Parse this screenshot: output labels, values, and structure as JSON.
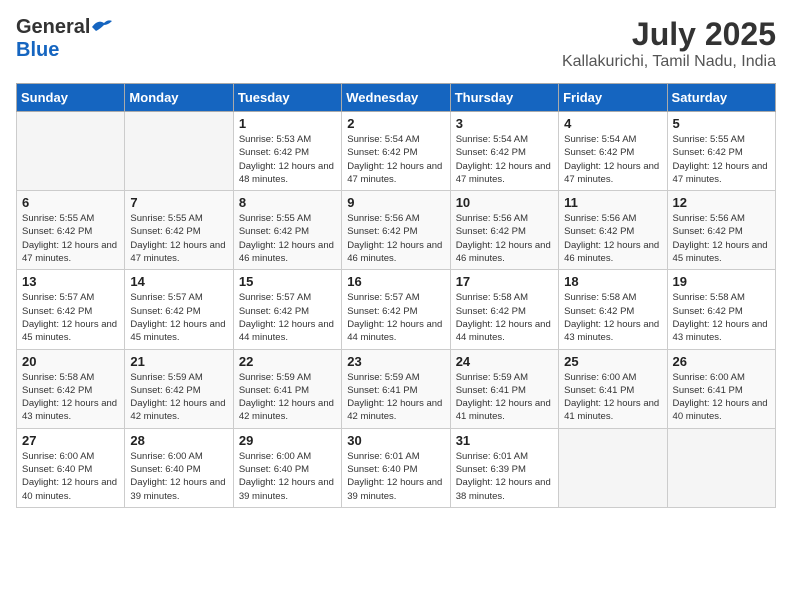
{
  "header": {
    "logo_general": "General",
    "logo_blue": "Blue",
    "month": "July 2025",
    "location": "Kallakurichi, Tamil Nadu, India"
  },
  "days_of_week": [
    "Sunday",
    "Monday",
    "Tuesday",
    "Wednesday",
    "Thursday",
    "Friday",
    "Saturday"
  ],
  "weeks": [
    [
      {
        "day": "",
        "info": ""
      },
      {
        "day": "",
        "info": ""
      },
      {
        "day": "1",
        "info": "Sunrise: 5:53 AM\nSunset: 6:42 PM\nDaylight: 12 hours and 48 minutes."
      },
      {
        "day": "2",
        "info": "Sunrise: 5:54 AM\nSunset: 6:42 PM\nDaylight: 12 hours and 47 minutes."
      },
      {
        "day": "3",
        "info": "Sunrise: 5:54 AM\nSunset: 6:42 PM\nDaylight: 12 hours and 47 minutes."
      },
      {
        "day": "4",
        "info": "Sunrise: 5:54 AM\nSunset: 6:42 PM\nDaylight: 12 hours and 47 minutes."
      },
      {
        "day": "5",
        "info": "Sunrise: 5:55 AM\nSunset: 6:42 PM\nDaylight: 12 hours and 47 minutes."
      }
    ],
    [
      {
        "day": "6",
        "info": "Sunrise: 5:55 AM\nSunset: 6:42 PM\nDaylight: 12 hours and 47 minutes."
      },
      {
        "day": "7",
        "info": "Sunrise: 5:55 AM\nSunset: 6:42 PM\nDaylight: 12 hours and 47 minutes."
      },
      {
        "day": "8",
        "info": "Sunrise: 5:55 AM\nSunset: 6:42 PM\nDaylight: 12 hours and 46 minutes."
      },
      {
        "day": "9",
        "info": "Sunrise: 5:56 AM\nSunset: 6:42 PM\nDaylight: 12 hours and 46 minutes."
      },
      {
        "day": "10",
        "info": "Sunrise: 5:56 AM\nSunset: 6:42 PM\nDaylight: 12 hours and 46 minutes."
      },
      {
        "day": "11",
        "info": "Sunrise: 5:56 AM\nSunset: 6:42 PM\nDaylight: 12 hours and 46 minutes."
      },
      {
        "day": "12",
        "info": "Sunrise: 5:56 AM\nSunset: 6:42 PM\nDaylight: 12 hours and 45 minutes."
      }
    ],
    [
      {
        "day": "13",
        "info": "Sunrise: 5:57 AM\nSunset: 6:42 PM\nDaylight: 12 hours and 45 minutes."
      },
      {
        "day": "14",
        "info": "Sunrise: 5:57 AM\nSunset: 6:42 PM\nDaylight: 12 hours and 45 minutes."
      },
      {
        "day": "15",
        "info": "Sunrise: 5:57 AM\nSunset: 6:42 PM\nDaylight: 12 hours and 44 minutes."
      },
      {
        "day": "16",
        "info": "Sunrise: 5:57 AM\nSunset: 6:42 PM\nDaylight: 12 hours and 44 minutes."
      },
      {
        "day": "17",
        "info": "Sunrise: 5:58 AM\nSunset: 6:42 PM\nDaylight: 12 hours and 44 minutes."
      },
      {
        "day": "18",
        "info": "Sunrise: 5:58 AM\nSunset: 6:42 PM\nDaylight: 12 hours and 43 minutes."
      },
      {
        "day": "19",
        "info": "Sunrise: 5:58 AM\nSunset: 6:42 PM\nDaylight: 12 hours and 43 minutes."
      }
    ],
    [
      {
        "day": "20",
        "info": "Sunrise: 5:58 AM\nSunset: 6:42 PM\nDaylight: 12 hours and 43 minutes."
      },
      {
        "day": "21",
        "info": "Sunrise: 5:59 AM\nSunset: 6:42 PM\nDaylight: 12 hours and 42 minutes."
      },
      {
        "day": "22",
        "info": "Sunrise: 5:59 AM\nSunset: 6:41 PM\nDaylight: 12 hours and 42 minutes."
      },
      {
        "day": "23",
        "info": "Sunrise: 5:59 AM\nSunset: 6:41 PM\nDaylight: 12 hours and 42 minutes."
      },
      {
        "day": "24",
        "info": "Sunrise: 5:59 AM\nSunset: 6:41 PM\nDaylight: 12 hours and 41 minutes."
      },
      {
        "day": "25",
        "info": "Sunrise: 6:00 AM\nSunset: 6:41 PM\nDaylight: 12 hours and 41 minutes."
      },
      {
        "day": "26",
        "info": "Sunrise: 6:00 AM\nSunset: 6:41 PM\nDaylight: 12 hours and 40 minutes."
      }
    ],
    [
      {
        "day": "27",
        "info": "Sunrise: 6:00 AM\nSunset: 6:40 PM\nDaylight: 12 hours and 40 minutes."
      },
      {
        "day": "28",
        "info": "Sunrise: 6:00 AM\nSunset: 6:40 PM\nDaylight: 12 hours and 39 minutes."
      },
      {
        "day": "29",
        "info": "Sunrise: 6:00 AM\nSunset: 6:40 PM\nDaylight: 12 hours and 39 minutes."
      },
      {
        "day": "30",
        "info": "Sunrise: 6:01 AM\nSunset: 6:40 PM\nDaylight: 12 hours and 39 minutes."
      },
      {
        "day": "31",
        "info": "Sunrise: 6:01 AM\nSunset: 6:39 PM\nDaylight: 12 hours and 38 minutes."
      },
      {
        "day": "",
        "info": ""
      },
      {
        "day": "",
        "info": ""
      }
    ]
  ]
}
